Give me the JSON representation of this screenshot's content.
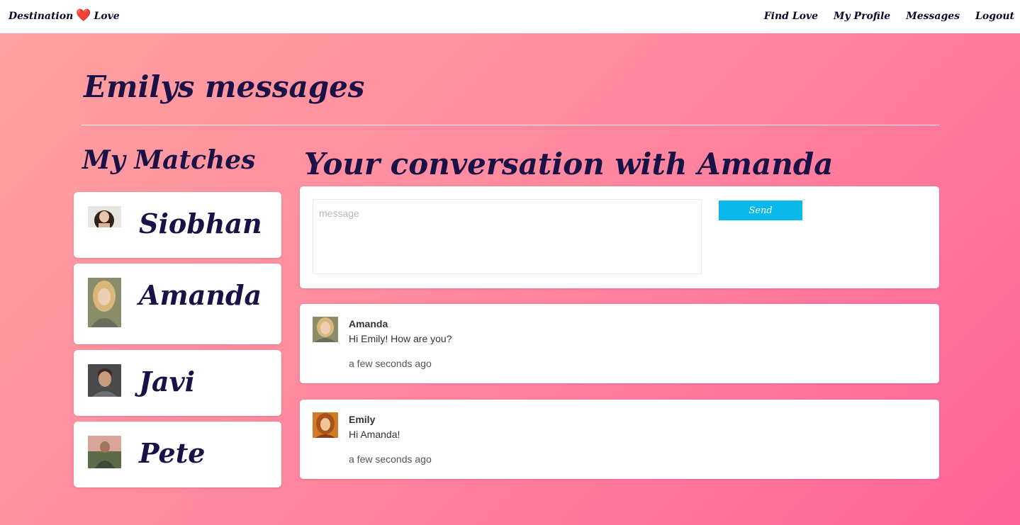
{
  "navbar": {
    "brand_left": "Destination",
    "brand_heart": "❤️",
    "brand_right": "Love",
    "links": [
      "Find Love",
      "My Profile",
      "Messages",
      "Logout"
    ]
  },
  "page_title": "Emilys messages",
  "matches": {
    "title": "My Matches",
    "items": [
      {
        "name": "Siobhan"
      },
      {
        "name": "Amanda"
      },
      {
        "name": "Javi"
      },
      {
        "name": "Pete"
      }
    ]
  },
  "conversation": {
    "title": "Your conversation with Amanda",
    "compose": {
      "placeholder": "message",
      "value": "",
      "send_label": "Send"
    },
    "messages": [
      {
        "author": "Amanda",
        "text": "Hi Emily! How are you?",
        "time": "a few seconds ago"
      },
      {
        "author": "Emily",
        "text": "Hi Amanda!",
        "time": "a few seconds ago"
      }
    ]
  },
  "colors": {
    "gradient_start": "#ffa3a0",
    "gradient_end": "#ff6498",
    "heading": "#1a1147",
    "send_button": "#0bb8ea"
  }
}
